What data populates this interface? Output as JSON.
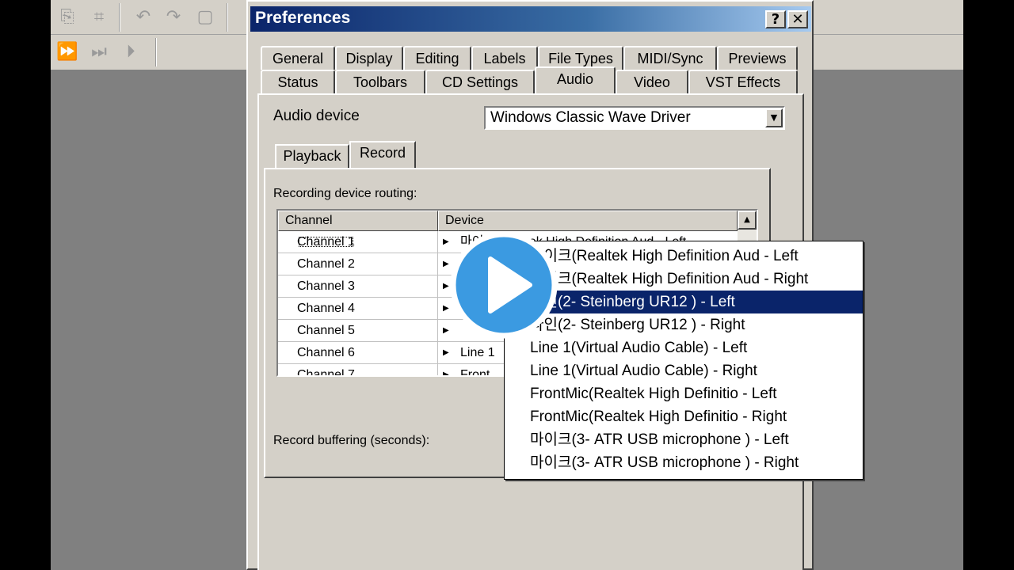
{
  "dialog": {
    "title": "Preferences",
    "help_button": "?",
    "close_button": "✕"
  },
  "tabs_row1": [
    "General",
    "Display",
    "Editing",
    "Labels",
    "File Types",
    "MIDI/Sync",
    "Previews"
  ],
  "tabs_row2": [
    "Status",
    "Toolbars",
    "CD Settings",
    "Audio",
    "Video",
    "VST Effects"
  ],
  "active_tab": "Audio",
  "audio": {
    "device_label": "Audio device",
    "device_value": "Windows Classic Wave Driver",
    "subtabs": [
      "Playback",
      "Record"
    ],
    "active_subtab": "Record",
    "routing_label": "Recording device routing:",
    "buffering_label": "Record buffering (seconds):"
  },
  "grid": {
    "headers": [
      "Channel",
      "Device"
    ],
    "rows": [
      {
        "channel": "Channel 1",
        "device": "마이크(Realtek High Definition Aud - Left"
      },
      {
        "channel": "Channel 2",
        "device": ""
      },
      {
        "channel": "Channel 3",
        "device": ""
      },
      {
        "channel": "Channel 4",
        "device": ""
      },
      {
        "channel": "Channel 5",
        "device": ""
      },
      {
        "channel": "Channel 6",
        "device": "Line 1"
      },
      {
        "channel": "Channel 7",
        "device": "Front"
      }
    ]
  },
  "dropdown": {
    "items": [
      "마이크(Realtek High Definition Aud - Left",
      "마이크(Realtek High Definition Aud - Right",
      "라인(2- Steinberg UR12 ) - Left",
      "라인(2- Steinberg UR12 ) - Right",
      "Line 1(Virtual Audio Cable) - Left",
      "Line 1(Virtual Audio Cable) - Right",
      "FrontMic(Realtek High Definitio - Left",
      "FrontMic(Realtek High Definitio - Right",
      "마이크(3- ATR USB microphone ) - Left",
      "마이크(3- ATR USB microphone ) - Right"
    ],
    "selected_index": 2
  },
  "colors": {
    "selection": "#0a246a",
    "play_button": "#3b9ae1"
  }
}
